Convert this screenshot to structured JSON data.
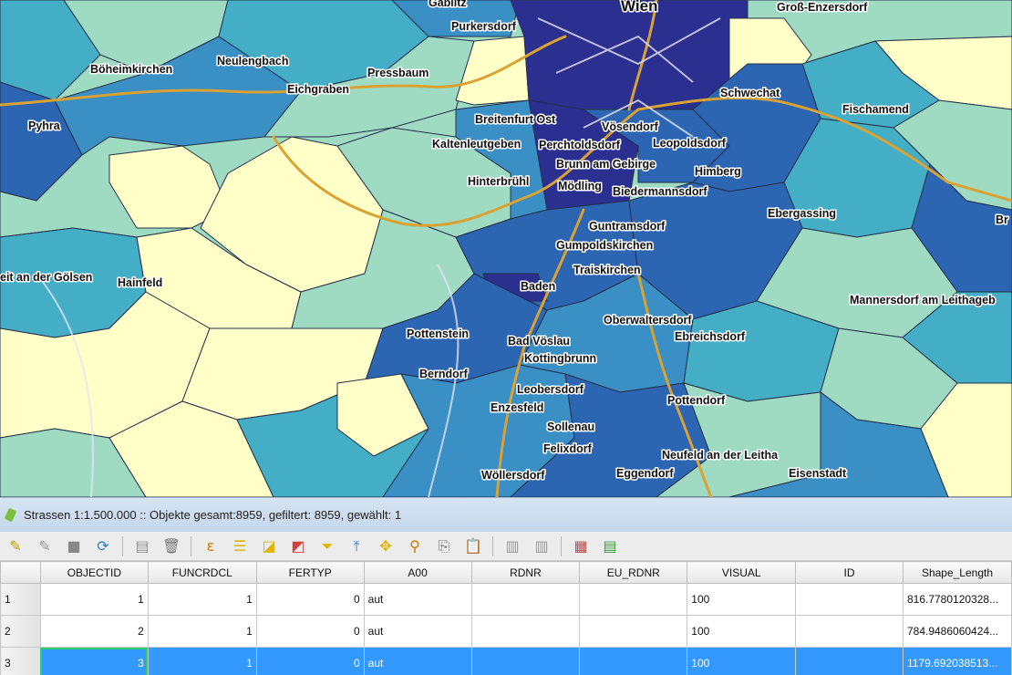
{
  "map": {
    "places": [
      {
        "name": "Wien",
        "size": "big"
      },
      {
        "name": "Gablitz",
        "size": "normal"
      },
      {
        "name": "Purkersdorf",
        "size": "normal"
      },
      {
        "name": "Groß-Enzersdorf",
        "size": "normal"
      },
      {
        "name": "Böheimkirchen",
        "size": "normal"
      },
      {
        "name": "Neulengbach",
        "size": "normal"
      },
      {
        "name": "Pressbaum",
        "size": "normal"
      },
      {
        "name": "Eichgraben",
        "size": "normal"
      },
      {
        "name": "Schwechat",
        "size": "normal"
      },
      {
        "name": "Pyhra",
        "size": "normal"
      },
      {
        "name": "Breitenfurt Ost",
        "size": "normal"
      },
      {
        "name": "Vösendorf",
        "size": "normal"
      },
      {
        "name": "Fischamend",
        "size": "normal"
      },
      {
        "name": "Kaltenleutgeben",
        "size": "normal"
      },
      {
        "name": "Perchtoldsdorf",
        "size": "normal"
      },
      {
        "name": "Leopoldsdorf",
        "size": "normal"
      },
      {
        "name": "Brunn am Gebirge",
        "size": "normal"
      },
      {
        "name": "Himberg",
        "size": "normal"
      },
      {
        "name": "Hinterbrühl",
        "size": "normal"
      },
      {
        "name": "Mödling",
        "size": "normal"
      },
      {
        "name": "Biedermannsdorf",
        "size": "normal"
      },
      {
        "name": "Ebergassing",
        "size": "normal"
      },
      {
        "name": "Guntramsdorf",
        "size": "normal"
      },
      {
        "name": "Br",
        "size": "normal"
      },
      {
        "name": "Gumpoldskirchen",
        "size": "normal"
      },
      {
        "name": "Traiskirchen",
        "size": "normal"
      },
      {
        "name": "eit an der Gölsen",
        "size": "normal"
      },
      {
        "name": "Hainfeld",
        "size": "normal"
      },
      {
        "name": "Baden",
        "size": "normal"
      },
      {
        "name": "Mannersdorf am Leithageb",
        "size": "normal"
      },
      {
        "name": "Oberwaltersdorf",
        "size": "normal"
      },
      {
        "name": "Ebreichsdorf",
        "size": "normal"
      },
      {
        "name": "Bad Vöslau",
        "size": "normal"
      },
      {
        "name": "Pottenstein",
        "size": "normal"
      },
      {
        "name": "Kottingbrunn",
        "size": "normal"
      },
      {
        "name": "Berndorf",
        "size": "normal"
      },
      {
        "name": "Leobersdorf",
        "size": "normal"
      },
      {
        "name": "Pottendorf",
        "size": "normal"
      },
      {
        "name": "Enzesfeld",
        "size": "normal"
      },
      {
        "name": "Sollenau",
        "size": "normal"
      },
      {
        "name": "Felixdorf",
        "size": "normal"
      },
      {
        "name": "Neufeld an der Leitha",
        "size": "normal"
      },
      {
        "name": "Wöllersdorf",
        "size": "normal"
      },
      {
        "name": "Eggendorf",
        "size": "normal"
      },
      {
        "name": "Eisenstadt",
        "size": "normal"
      }
    ],
    "colors": {
      "darkest": "#2b2f8f",
      "dark": "#2c66b3",
      "mid": "#3a8fc4",
      "teal": "#43aec6",
      "light": "#9fdbc2",
      "pale": "#c8ecd6",
      "cream": "#ffffc8",
      "road": "#d9a233"
    }
  },
  "attribute_table": {
    "title": "Strassen 1:1.500.000 :: Objekte gesamt:8959, gefiltert: 8959, gewählt: 1",
    "toolbar_icons": [
      "edit-pencil-icon",
      "toggle-edit-icon",
      "save-icon",
      "reload-icon",
      "add-feature-icon",
      "delete-icon",
      "select-expression-icon",
      "select-all-icon",
      "invert-selection-icon",
      "deselect-icon",
      "filter-icon",
      "move-top-icon",
      "pan-to-selection-icon",
      "zoom-to-selection-icon",
      "copy-icon",
      "paste-icon",
      "new-column-icon",
      "delete-column-icon",
      "field-calculator-icon",
      "conditional-format-icon"
    ],
    "columns": [
      "OBJECTID",
      "FUNCRDCL",
      "FERTYP",
      "A00",
      "RDNR",
      "EU_RDNR",
      "VISUAL",
      "ID",
      "Shape_Length"
    ],
    "rows": [
      {
        "row": "1",
        "cells": [
          "1",
          "1",
          "0",
          "aut",
          "",
          "",
          "100",
          "",
          "816.7780120328..."
        ]
      },
      {
        "row": "2",
        "cells": [
          "2",
          "1",
          "0",
          "aut",
          "",
          "",
          "100",
          "",
          "784.9486060424..."
        ]
      },
      {
        "row": "3",
        "cells": [
          "3",
          "1",
          "0",
          "aut",
          "",
          "",
          "100",
          "",
          "1179.692038513..."
        ],
        "selected": true
      }
    ]
  }
}
